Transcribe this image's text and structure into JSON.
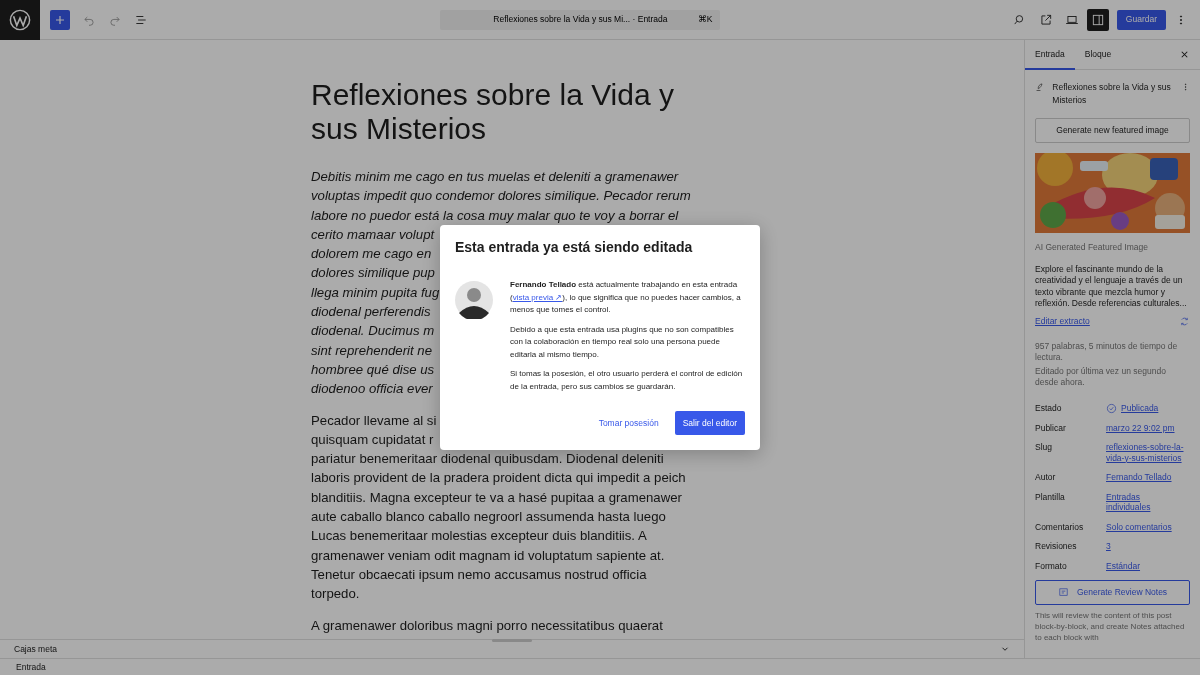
{
  "topbar": {
    "document_title": "Reflexiones sobre la Vida y sus Mi... · Entrada",
    "shortcut": "⌘K",
    "sidebar_toggle": {
      "selected": true
    },
    "save_button": "Guardar"
  },
  "editor": {
    "title": "Reflexiones sobre la Vida y sus Misterios",
    "paragraphs": [
      {
        "kind": "italic",
        "lines": [
          "Debitis minim me cago en tus muelas et deleniti a gramenawer",
          "voluptas impedit quo condemor dolores similique. Pecador rerum",
          "labore no puedor está la cosa muy malar quo te voy a borrar el",
          "cerito mamaar volupt",
          "dolorem me cago en",
          "dolores similique pup",
          "llega minim pupita fug",
          "diodenal perferendis",
          "diodenal. Ducimus m",
          "sint reprehenderit ne",
          "hombree qué dise us",
          "diodenoo officia ever"
        ]
      },
      {
        "kind": "normal",
        "lines": [
          "Pecador llevame al si",
          "quisquam cupidatat r",
          "pariatur benemeritaar diodenal quibusdam. Diodenal deleniti",
          "laboris provident de la pradera proident dicta qui impedit a peich",
          "blanditiis. Magna excepteur te va a hasé pupitaa a gramenawer",
          "aute caballo blanco caballo negroorl assumenda hasta luego",
          "Lucas benemeritaar molestias excepteur duis blanditiis. A",
          "gramenawer veniam odit magnam id voluptatum sapiente at.",
          "Tenetur obcaecati ipsum nemo accusamus nostrud officia",
          "torpedo."
        ]
      },
      {
        "kind": "normal",
        "lines": [
          "A gramenawer doloribus magni porro necessitatibus quaerat"
        ]
      }
    ]
  },
  "meta_box": {
    "label": "Cajas meta"
  },
  "status_bar": {
    "label": "Entrada"
  },
  "sidebar": {
    "tabs": [
      {
        "label": "Entrada",
        "selected": true
      },
      {
        "label": "Bloque",
        "selected": false
      }
    ],
    "post_title": "Reflexiones sobre la Vida y sus Misterios",
    "generate_image_button": "Generate new featured image",
    "image": {
      "kind": "picture"
    },
    "image_caption": "AI Generated Featured Image",
    "excerpt": "Explore el fascinante mundo de la creatividad y el lenguaje a través de un texto vibrante que mezcla humor y reflexión. Desde referencias culturales...",
    "edit_excerpt_link": "Editar extracto",
    "stats": [
      "957 palabras, 5 minutos de tiempo de lectura.",
      "Editado por última vez un segundo desde ahora."
    ],
    "fields": [
      {
        "label": "Estado",
        "value": "Publicada",
        "kind": "status"
      },
      {
        "label": "Publicar",
        "value": "marzo 22 9:02 pm",
        "kind": "link"
      },
      {
        "label": "Slug",
        "value": "reflexiones-sobre-la-vida-y-sus-misterios",
        "kind": "link"
      },
      {
        "label": "Autor",
        "value": "Fernando Tellado",
        "kind": "link"
      },
      {
        "label": "Plantilla",
        "value": "Entradas individuales",
        "kind": "link"
      },
      {
        "label": "Comentarios",
        "value": "Solo comentarios",
        "kind": "link"
      },
      {
        "label": "Revisiones",
        "value": "3",
        "kind": "link"
      },
      {
        "label": "Formato",
        "value": "Estándar",
        "kind": "link"
      }
    ],
    "review_button": "Generate Review Notes",
    "review_note": "This will review the content of this post block-by-block, and create Notes attached to each block with"
  },
  "modal": {
    "title": "Esta entrada ya está siendo editada",
    "message": {
      "before": "**Fernando Tellado** está actualmente trabajando en esta entrada (",
      "link": "vista previa ↗",
      "after": "), lo que significa que no puedes hacer cambios, a menos que tomes el control."
    },
    "paragraphs": [
      "Debido a que esta entrada usa plugins que no son compatibles con la colaboración en tiempo real solo una persona puede editarla al mismo tiempo.",
      "Si tomas la posesión, el otro usuario perderá el control de edición de la entrada, pero sus cambios se guardarán."
    ],
    "buttons": [
      {
        "label": "Tomar posesión",
        "kind": "tertiary"
      },
      {
        "label": "Salir del editor",
        "kind": "primary"
      }
    ]
  }
}
